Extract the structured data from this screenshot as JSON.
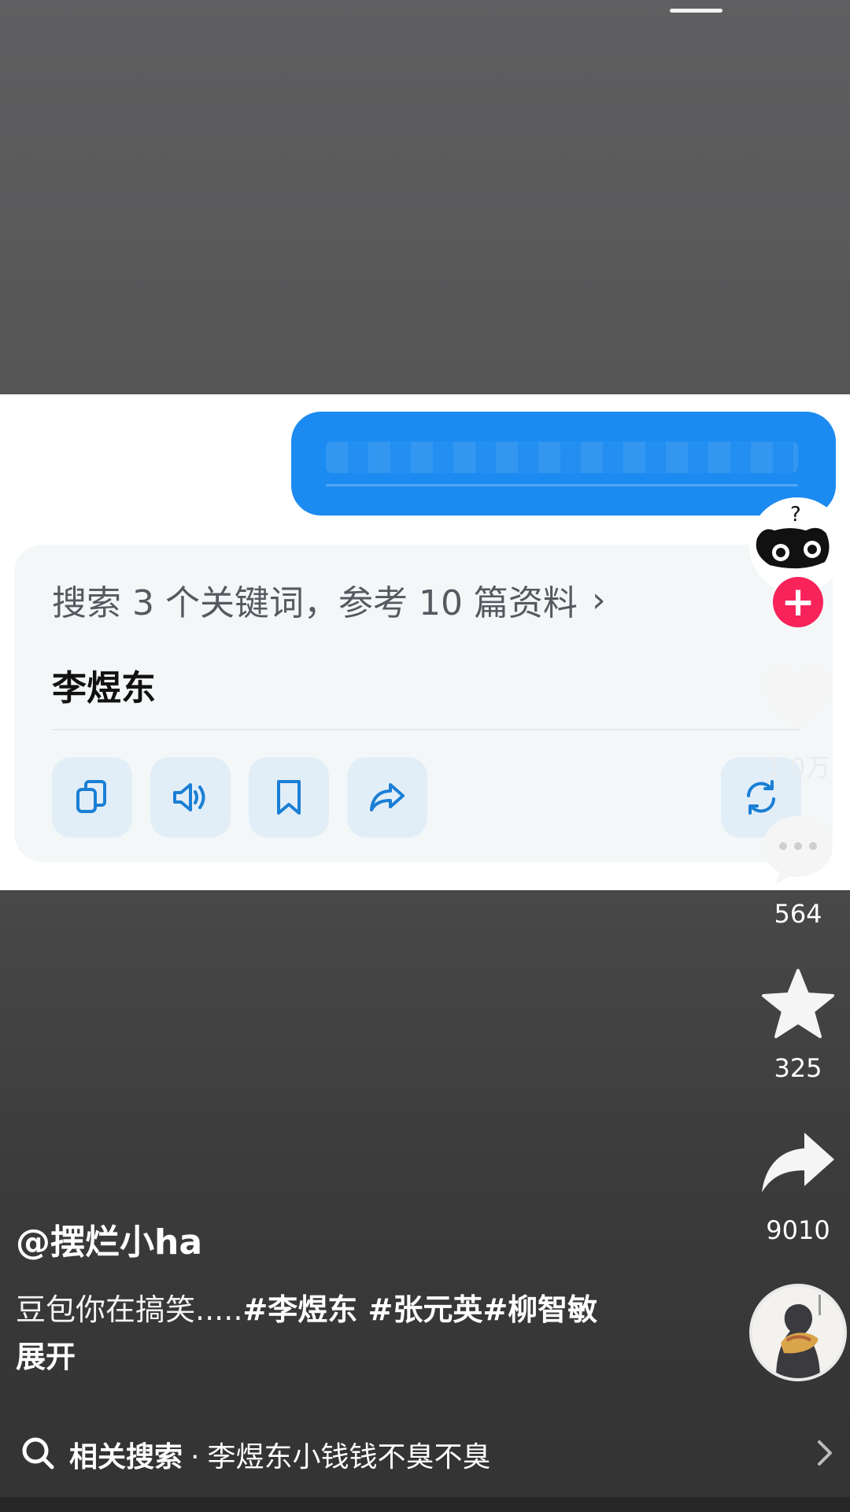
{
  "answer_panel": {
    "search_summary": "搜索 3 个关键词，参考 10 篇资料",
    "chevron": "›",
    "title": "李煜东",
    "actions": [
      {
        "icon": "copy-icon"
      },
      {
        "icon": "speaker-icon"
      },
      {
        "icon": "bookmark-icon"
      },
      {
        "icon": "share-arrow-icon"
      },
      {
        "icon": "regenerate-icon"
      }
    ]
  },
  "rail": {
    "likes": "1.0万",
    "comments": "564",
    "favorites": "325",
    "shares": "9010",
    "follow_symbol": "+"
  },
  "video": {
    "author": "@摆烂小ha",
    "caption": "豆包你在搞笑.....",
    "hashtags": "#李煜东 #张元英#柳智敏",
    "expand": "展开"
  },
  "related_search": {
    "label": "相关搜索",
    "separator": "·",
    "query": "李煜东小钱钱不臭不臭"
  },
  "colors": {
    "bubble_blue": "#1c8bf1",
    "action_blue": "#1a7fd6",
    "follow_red": "#f7235a"
  }
}
